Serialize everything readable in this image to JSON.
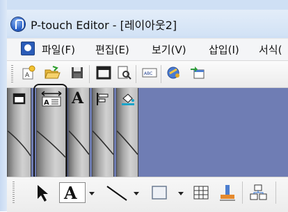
{
  "window": {
    "title": "P-touch Editor - [레이아웃2]"
  },
  "menubar": {
    "items": [
      {
        "label": "파일(F)"
      },
      {
        "label": "편집(E)"
      },
      {
        "label": "보기(V)"
      },
      {
        "label": "삽입(I)"
      },
      {
        "label": "서식("
      }
    ]
  },
  "side_tabs": {
    "letter_tab_glyph": "A"
  },
  "bottom_toolbar": {
    "text_tool_glyph": "A"
  },
  "colors": {
    "work_area": "#6f7db4",
    "frame": "#cfe0f5",
    "highlight_box": "#1a1a1a"
  }
}
